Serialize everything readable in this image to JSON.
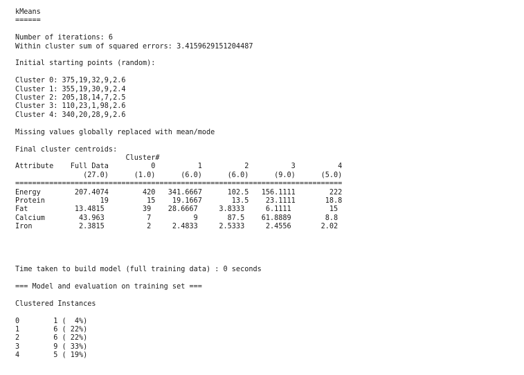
{
  "output": {
    "lines": [
      "kMeans",
      "======",
      "",
      "Number of iterations: 6",
      "Within cluster sum of squared errors: 3.4159629151204487",
      "",
      "Initial starting points (random):",
      "",
      "Cluster 0: 375,19,32,9,2.6",
      "Cluster 1: 355,19,30,9,2.4",
      "Cluster 2: 205,18,14,7,2.5",
      "Cluster 3: 110,23,1,98,2.6",
      "Cluster 4: 340,20,28,9,2.6",
      "",
      "Missing values globally replaced with mean/mode",
      "",
      "Final cluster centroids:",
      "                          Cluster#",
      "Attribute    Full Data          0          1          2          3          4",
      "                (27.0)      (1.0)      (6.0)      (6.0)      (9.0)      (5.0)",
      "=============================================================================",
      "Energy        207.4074        420   341.6667      102.5   156.1111        222",
      "Protein             19         15    19.1667       13.5    23.1111       18.8",
      "Fat           13.4815         39    28.6667     3.8333     6.1111         15",
      "Calcium        43.963          7          9       87.5    61.8889        8.8",
      "Iron           2.3815          2     2.4833     2.5333     2.4556       2.02",
      "",
      "",
      "",
      "",
      "Time taken to build model (full training data) : 0 seconds",
      "",
      "=== Model and evaluation on training set ===",
      "",
      "Clustered Instances",
      "",
      "0        1 (  4%)",
      "1        6 ( 22%)",
      "2        6 ( 22%)",
      "3        9 ( 33%)",
      "4        5 ( 19%)"
    ]
  }
}
